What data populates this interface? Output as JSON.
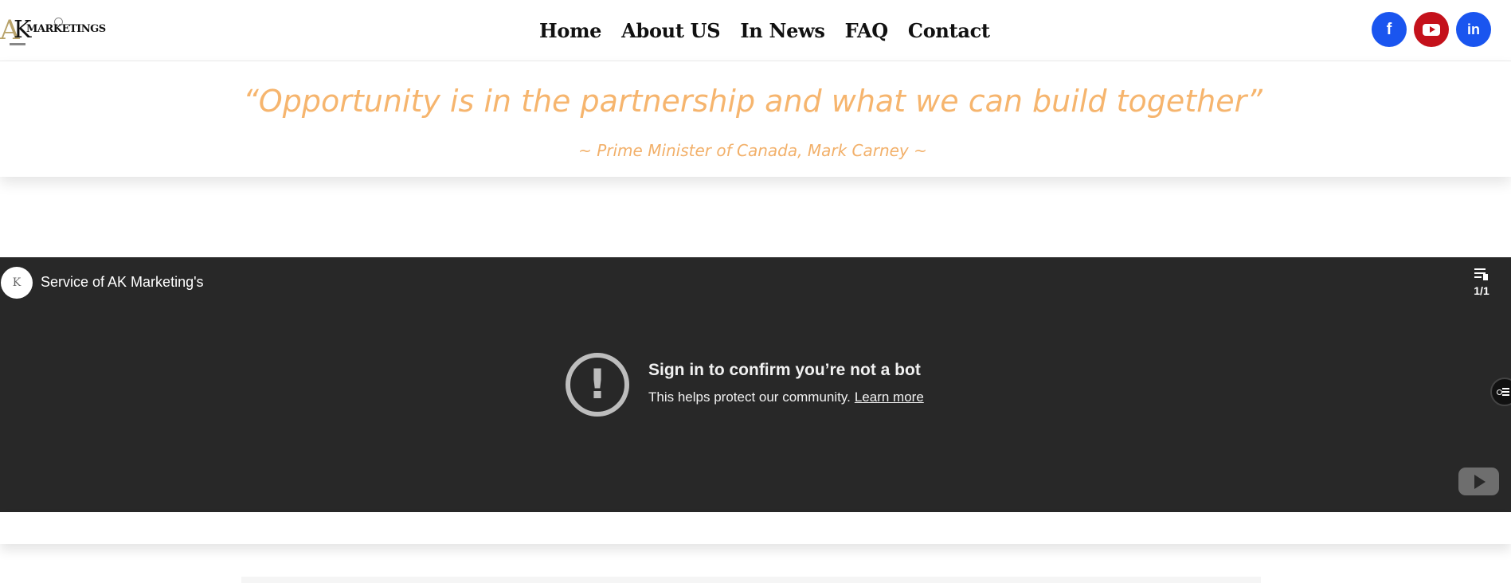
{
  "header": {
    "logo": {
      "mark": "A",
      "k": "K",
      "text": "MARKETINGS"
    },
    "nav": [
      {
        "label": "Home"
      },
      {
        "label": "About US"
      },
      {
        "label": "In News"
      },
      {
        "label": "FAQ"
      },
      {
        "label": "Contact"
      }
    ],
    "social": [
      {
        "name": "facebook",
        "glyph": "f",
        "color": "#1a55ef"
      },
      {
        "name": "youtube",
        "glyph": "",
        "color": "#c4111b"
      },
      {
        "name": "linkedin",
        "glyph": "in",
        "color": "#1a55ef"
      }
    ]
  },
  "quote": {
    "text": "“Opportunity is in the partnership and what we can build together”",
    "author": "~ Prime Minister of Canada, Mark Carney ~",
    "color": "#f6b56e"
  },
  "video": {
    "channel_avatar": "K",
    "title": "Service of AK Marketing's",
    "playlist_count": "1/1",
    "error_icon": "!",
    "error_title": "Sign in to confirm you’re not a bot",
    "error_message": "This helps protect our community.",
    "learn_more": "Learn more",
    "background": "#282828"
  }
}
